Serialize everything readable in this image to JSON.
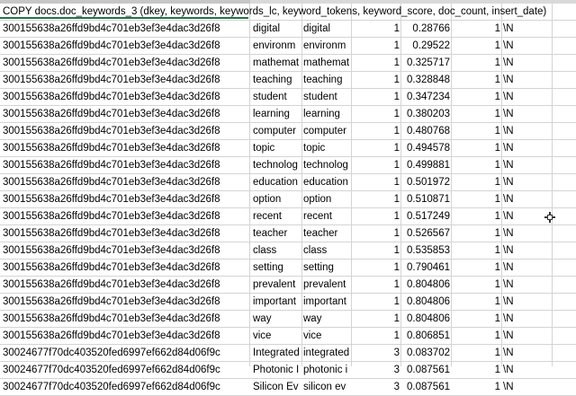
{
  "header": "COPY docs.doc_keywords_3 (dkey, keywords, keywords_lc, keyword_tokens, keyword_score, doc_count, insert_date)",
  "rows": [
    {
      "dkey": "300155638a26ffd9bd4c701eb3ef3e4dac3d26f8",
      "kw": "digital",
      "kwlc": "digital",
      "tok": "1",
      "score": "0.28766",
      "cnt": "1",
      "date": "\\N"
    },
    {
      "dkey": "300155638a26ffd9bd4c701eb3ef3e4dac3d26f8",
      "kw": "environm",
      "kwlc": "environm",
      "tok": "1",
      "score": "0.29522",
      "cnt": "1",
      "date": "\\N"
    },
    {
      "dkey": "300155638a26ffd9bd4c701eb3ef3e4dac3d26f8",
      "kw": "mathemat",
      "kwlc": "mathemat",
      "tok": "1",
      "score": "0.325717",
      "cnt": "1",
      "date": "\\N"
    },
    {
      "dkey": "300155638a26ffd9bd4c701eb3ef3e4dac3d26f8",
      "kw": "teaching",
      "kwlc": "teaching",
      "tok": "1",
      "score": "0.328848",
      "cnt": "1",
      "date": "\\N"
    },
    {
      "dkey": "300155638a26ffd9bd4c701eb3ef3e4dac3d26f8",
      "kw": "student",
      "kwlc": "student",
      "tok": "1",
      "score": "0.347234",
      "cnt": "1",
      "date": "\\N"
    },
    {
      "dkey": "300155638a26ffd9bd4c701eb3ef3e4dac3d26f8",
      "kw": "learning",
      "kwlc": "learning",
      "tok": "1",
      "score": "0.380203",
      "cnt": "1",
      "date": "\\N"
    },
    {
      "dkey": "300155638a26ffd9bd4c701eb3ef3e4dac3d26f8",
      "kw": "computer",
      "kwlc": "computer",
      "tok": "1",
      "score": "0.480768",
      "cnt": "1",
      "date": "\\N"
    },
    {
      "dkey": "300155638a26ffd9bd4c701eb3ef3e4dac3d26f8",
      "kw": "topic",
      "kwlc": "topic",
      "tok": "1",
      "score": "0.494578",
      "cnt": "1",
      "date": "\\N"
    },
    {
      "dkey": "300155638a26ffd9bd4c701eb3ef3e4dac3d26f8",
      "kw": "technolog",
      "kwlc": "technolog",
      "tok": "1",
      "score": "0.499881",
      "cnt": "1",
      "date": "\\N"
    },
    {
      "dkey": "300155638a26ffd9bd4c701eb3ef3e4dac3d26f8",
      "kw": "education",
      "kwlc": "education",
      "tok": "1",
      "score": "0.501972",
      "cnt": "1",
      "date": "\\N"
    },
    {
      "dkey": "300155638a26ffd9bd4c701eb3ef3e4dac3d26f8",
      "kw": "option",
      "kwlc": "option",
      "tok": "1",
      "score": "0.510871",
      "cnt": "1",
      "date": "\\N"
    },
    {
      "dkey": "300155638a26ffd9bd4c701eb3ef3e4dac3d26f8",
      "kw": "recent",
      "kwlc": "recent",
      "tok": "1",
      "score": "0.517249",
      "cnt": "1",
      "date": "\\N"
    },
    {
      "dkey": "300155638a26ffd9bd4c701eb3ef3e4dac3d26f8",
      "kw": "teacher",
      "kwlc": "teacher",
      "tok": "1",
      "score": "0.526567",
      "cnt": "1",
      "date": "\\N"
    },
    {
      "dkey": "300155638a26ffd9bd4c701eb3ef3e4dac3d26f8",
      "kw": "class",
      "kwlc": "class",
      "tok": "1",
      "score": "0.535853",
      "cnt": "1",
      "date": "\\N"
    },
    {
      "dkey": "300155638a26ffd9bd4c701eb3ef3e4dac3d26f8",
      "kw": "setting",
      "kwlc": "setting",
      "tok": "1",
      "score": "0.790461",
      "cnt": "1",
      "date": "\\N"
    },
    {
      "dkey": "300155638a26ffd9bd4c701eb3ef3e4dac3d26f8",
      "kw": "prevalent",
      "kwlc": "prevalent",
      "tok": "1",
      "score": "0.804806",
      "cnt": "1",
      "date": "\\N"
    },
    {
      "dkey": "300155638a26ffd9bd4c701eb3ef3e4dac3d26f8",
      "kw": "important",
      "kwlc": "important",
      "tok": "1",
      "score": "0.804806",
      "cnt": "1",
      "date": "\\N"
    },
    {
      "dkey": "300155638a26ffd9bd4c701eb3ef3e4dac3d26f8",
      "kw": "way",
      "kwlc": "way",
      "tok": "1",
      "score": "0.804806",
      "cnt": "1",
      "date": "\\N"
    },
    {
      "dkey": "300155638a26ffd9bd4c701eb3ef3e4dac3d26f8",
      "kw": "vice",
      "kwlc": "vice",
      "tok": "1",
      "score": "0.806851",
      "cnt": "1",
      "date": "\\N"
    },
    {
      "dkey": "30024677f70dc403520fed6997ef662d84d06f9c",
      "kw": "Integrated",
      "kwlc": "integrated",
      "tok": "3",
      "score": "0.083702",
      "cnt": "1",
      "date": "\\N"
    },
    {
      "dkey": "30024677f70dc403520fed6997ef662d84d06f9c",
      "kw": "Photonic I",
      "kwlc": "photonic i",
      "tok": "3",
      "score": "0.087561",
      "cnt": "1",
      "date": "\\N"
    },
    {
      "dkey": "30024677f70dc403520fed6997ef662d84d06f9c",
      "kw": "Silicon Ev",
      "kwlc": "silicon ev",
      "tok": "3",
      "score": "0.087561",
      "cnt": "1",
      "date": "\\N"
    }
  ]
}
